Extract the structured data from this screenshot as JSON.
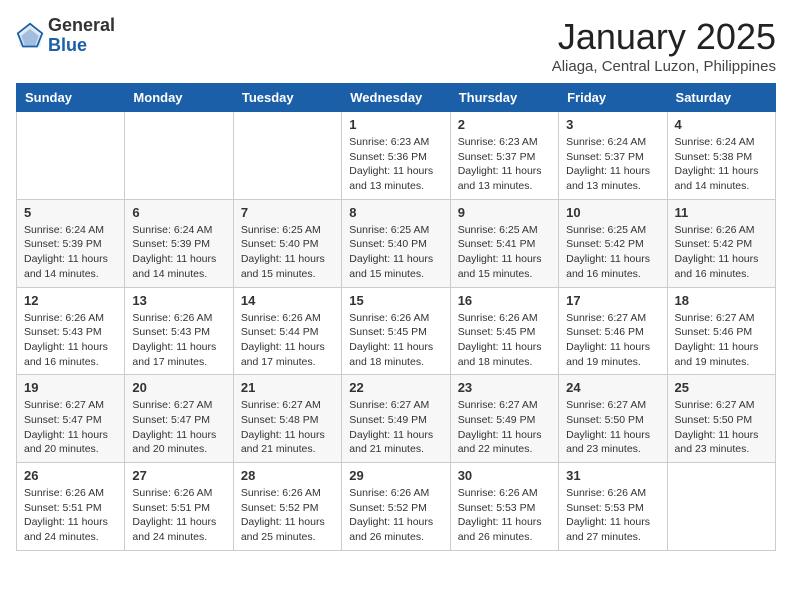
{
  "header": {
    "logo_general": "General",
    "logo_blue": "Blue",
    "month": "January 2025",
    "location": "Aliaga, Central Luzon, Philippines"
  },
  "weekdays": [
    "Sunday",
    "Monday",
    "Tuesday",
    "Wednesday",
    "Thursday",
    "Friday",
    "Saturday"
  ],
  "weeks": [
    [
      {
        "day": "",
        "sunrise": "",
        "sunset": "",
        "daylight": ""
      },
      {
        "day": "",
        "sunrise": "",
        "sunset": "",
        "daylight": ""
      },
      {
        "day": "",
        "sunrise": "",
        "sunset": "",
        "daylight": ""
      },
      {
        "day": "1",
        "sunrise": "Sunrise: 6:23 AM",
        "sunset": "Sunset: 5:36 PM",
        "daylight": "Daylight: 11 hours and 13 minutes."
      },
      {
        "day": "2",
        "sunrise": "Sunrise: 6:23 AM",
        "sunset": "Sunset: 5:37 PM",
        "daylight": "Daylight: 11 hours and 13 minutes."
      },
      {
        "day": "3",
        "sunrise": "Sunrise: 6:24 AM",
        "sunset": "Sunset: 5:37 PM",
        "daylight": "Daylight: 11 hours and 13 minutes."
      },
      {
        "day": "4",
        "sunrise": "Sunrise: 6:24 AM",
        "sunset": "Sunset: 5:38 PM",
        "daylight": "Daylight: 11 hours and 14 minutes."
      }
    ],
    [
      {
        "day": "5",
        "sunrise": "Sunrise: 6:24 AM",
        "sunset": "Sunset: 5:39 PM",
        "daylight": "Daylight: 11 hours and 14 minutes."
      },
      {
        "day": "6",
        "sunrise": "Sunrise: 6:24 AM",
        "sunset": "Sunset: 5:39 PM",
        "daylight": "Daylight: 11 hours and 14 minutes."
      },
      {
        "day": "7",
        "sunrise": "Sunrise: 6:25 AM",
        "sunset": "Sunset: 5:40 PM",
        "daylight": "Daylight: 11 hours and 15 minutes."
      },
      {
        "day": "8",
        "sunrise": "Sunrise: 6:25 AM",
        "sunset": "Sunset: 5:40 PM",
        "daylight": "Daylight: 11 hours and 15 minutes."
      },
      {
        "day": "9",
        "sunrise": "Sunrise: 6:25 AM",
        "sunset": "Sunset: 5:41 PM",
        "daylight": "Daylight: 11 hours and 15 minutes."
      },
      {
        "day": "10",
        "sunrise": "Sunrise: 6:25 AM",
        "sunset": "Sunset: 5:42 PM",
        "daylight": "Daylight: 11 hours and 16 minutes."
      },
      {
        "day": "11",
        "sunrise": "Sunrise: 6:26 AM",
        "sunset": "Sunset: 5:42 PM",
        "daylight": "Daylight: 11 hours and 16 minutes."
      }
    ],
    [
      {
        "day": "12",
        "sunrise": "Sunrise: 6:26 AM",
        "sunset": "Sunset: 5:43 PM",
        "daylight": "Daylight: 11 hours and 16 minutes."
      },
      {
        "day": "13",
        "sunrise": "Sunrise: 6:26 AM",
        "sunset": "Sunset: 5:43 PM",
        "daylight": "Daylight: 11 hours and 17 minutes."
      },
      {
        "day": "14",
        "sunrise": "Sunrise: 6:26 AM",
        "sunset": "Sunset: 5:44 PM",
        "daylight": "Daylight: 11 hours and 17 minutes."
      },
      {
        "day": "15",
        "sunrise": "Sunrise: 6:26 AM",
        "sunset": "Sunset: 5:45 PM",
        "daylight": "Daylight: 11 hours and 18 minutes."
      },
      {
        "day": "16",
        "sunrise": "Sunrise: 6:26 AM",
        "sunset": "Sunset: 5:45 PM",
        "daylight": "Daylight: 11 hours and 18 minutes."
      },
      {
        "day": "17",
        "sunrise": "Sunrise: 6:27 AM",
        "sunset": "Sunset: 5:46 PM",
        "daylight": "Daylight: 11 hours and 19 minutes."
      },
      {
        "day": "18",
        "sunrise": "Sunrise: 6:27 AM",
        "sunset": "Sunset: 5:46 PM",
        "daylight": "Daylight: 11 hours and 19 minutes."
      }
    ],
    [
      {
        "day": "19",
        "sunrise": "Sunrise: 6:27 AM",
        "sunset": "Sunset: 5:47 PM",
        "daylight": "Daylight: 11 hours and 20 minutes."
      },
      {
        "day": "20",
        "sunrise": "Sunrise: 6:27 AM",
        "sunset": "Sunset: 5:47 PM",
        "daylight": "Daylight: 11 hours and 20 minutes."
      },
      {
        "day": "21",
        "sunrise": "Sunrise: 6:27 AM",
        "sunset": "Sunset: 5:48 PM",
        "daylight": "Daylight: 11 hours and 21 minutes."
      },
      {
        "day": "22",
        "sunrise": "Sunrise: 6:27 AM",
        "sunset": "Sunset: 5:49 PM",
        "daylight": "Daylight: 11 hours and 21 minutes."
      },
      {
        "day": "23",
        "sunrise": "Sunrise: 6:27 AM",
        "sunset": "Sunset: 5:49 PM",
        "daylight": "Daylight: 11 hours and 22 minutes."
      },
      {
        "day": "24",
        "sunrise": "Sunrise: 6:27 AM",
        "sunset": "Sunset: 5:50 PM",
        "daylight": "Daylight: 11 hours and 23 minutes."
      },
      {
        "day": "25",
        "sunrise": "Sunrise: 6:27 AM",
        "sunset": "Sunset: 5:50 PM",
        "daylight": "Daylight: 11 hours and 23 minutes."
      }
    ],
    [
      {
        "day": "26",
        "sunrise": "Sunrise: 6:26 AM",
        "sunset": "Sunset: 5:51 PM",
        "daylight": "Daylight: 11 hours and 24 minutes."
      },
      {
        "day": "27",
        "sunrise": "Sunrise: 6:26 AM",
        "sunset": "Sunset: 5:51 PM",
        "daylight": "Daylight: 11 hours and 24 minutes."
      },
      {
        "day": "28",
        "sunrise": "Sunrise: 6:26 AM",
        "sunset": "Sunset: 5:52 PM",
        "daylight": "Daylight: 11 hours and 25 minutes."
      },
      {
        "day": "29",
        "sunrise": "Sunrise: 6:26 AM",
        "sunset": "Sunset: 5:52 PM",
        "daylight": "Daylight: 11 hours and 26 minutes."
      },
      {
        "day": "30",
        "sunrise": "Sunrise: 6:26 AM",
        "sunset": "Sunset: 5:53 PM",
        "daylight": "Daylight: 11 hours and 26 minutes."
      },
      {
        "day": "31",
        "sunrise": "Sunrise: 6:26 AM",
        "sunset": "Sunset: 5:53 PM",
        "daylight": "Daylight: 11 hours and 27 minutes."
      },
      {
        "day": "",
        "sunrise": "",
        "sunset": "",
        "daylight": ""
      }
    ]
  ]
}
